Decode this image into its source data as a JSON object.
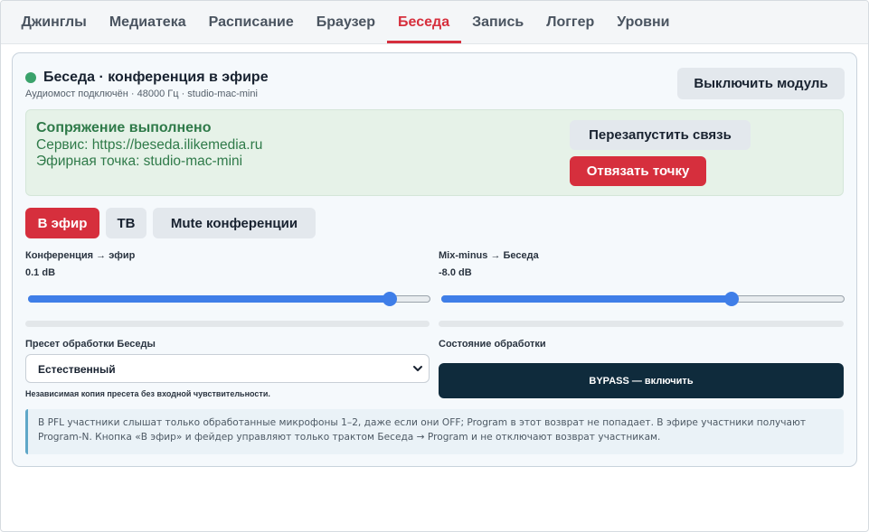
{
  "tabs": [
    {
      "label": "Джинглы",
      "active": false
    },
    {
      "label": "Медиатека",
      "active": false
    },
    {
      "label": "Расписание",
      "active": false
    },
    {
      "label": "Браузер",
      "active": false
    },
    {
      "label": "Беседа",
      "active": true
    },
    {
      "label": "Запись",
      "active": false
    },
    {
      "label": "Логгер",
      "active": false
    },
    {
      "label": "Уровни",
      "active": false
    }
  ],
  "module": {
    "title": "Беседа · конференция в эфире",
    "subtitle": "Аудиомост подключён · 48000 Гц · studio-mac-mini",
    "disable_label": "Выключить модуль",
    "status_color": "#3aa26b"
  },
  "pairing": {
    "title": "Сопряжение выполнено",
    "service": "Сервис: https://beseda.ilikemedia.ru",
    "endpoint": "Эфирная точка: studio-mac-mini",
    "restart_label": "Перезапустить связь",
    "unbind_label": "Отвязать точку"
  },
  "actions": {
    "on_air_label": "В эфир",
    "tb_label": "ТВ",
    "mute_label": "Mute конференции"
  },
  "faders": {
    "conference": {
      "label": "Конференция → эфир",
      "value": "0.1 dB",
      "position": 0.9
    },
    "mixminus": {
      "label": "Mix-minus → Беседа",
      "value": "-8.0 dB",
      "position": 0.72
    }
  },
  "processing": {
    "preset_label": "Пресет обработки Беседы",
    "preset_value": "Естественный",
    "preset_hint": "Независимая копия пресета без входной чувствительности.",
    "state_label": "Состояние обработки",
    "bypass_label": "BYPASS — включить"
  },
  "note": {
    "text": "В PFL участники слышат только обработанные микрофоны 1–2, даже если они OFF; Program в этот возврат не попадает. В эфире участники получают Program-N. Кнопка «В эфир» и фейдер управляют только трактом Беседа → Program и не отключают возврат участникам."
  },
  "colors": {
    "accent_red": "#d62f3d",
    "slider_blue": "#3f7ee8",
    "success_green": "#2f7a49",
    "dark_button": "#0f2b3c"
  }
}
